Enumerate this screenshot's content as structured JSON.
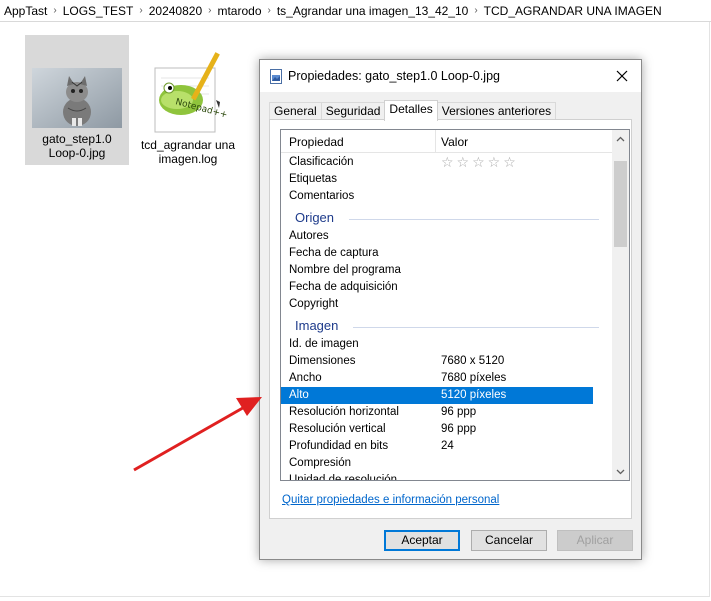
{
  "breadcrumb": [
    "AppTast",
    "LOGS_TEST",
    "20240820",
    "mtarodo",
    "ts_Agrandar una imagen_13_42_10",
    "TCD_AGRANDAR UNA IMAGEN"
  ],
  "files": [
    {
      "name_line1": "gato_step1.0",
      "name_line2": "Loop-0.jpg",
      "icon": "image-thumbnail-icon"
    },
    {
      "name_line1": "tcd_agrandar una",
      "name_line2": "imagen.log",
      "icon": "notepad-plus-plus-icon"
    }
  ],
  "dialog": {
    "title": "Propiedades: gato_step1.0 Loop-0.jpg",
    "tabs": [
      "General",
      "Seguridad",
      "Detalles",
      "Versiones anteriores"
    ],
    "active_tab": "Detalles",
    "header_property": "Propiedad",
    "header_value": "Valor",
    "rows_top": [
      {
        "key": "Clasificación",
        "value": "",
        "stars": "☆☆☆☆☆"
      },
      {
        "key": "Etiquetas",
        "value": ""
      },
      {
        "key": "Comentarios",
        "value": ""
      }
    ],
    "group_origin": "Origen",
    "rows_origin": [
      {
        "key": "Autores",
        "value": ""
      },
      {
        "key": "Fecha de captura",
        "value": ""
      },
      {
        "key": "Nombre del programa",
        "value": ""
      },
      {
        "key": "Fecha de adquisición",
        "value": ""
      },
      {
        "key": "Copyright",
        "value": ""
      }
    ],
    "group_image": "Imagen",
    "rows_image": [
      {
        "key": "Id. de imagen",
        "value": ""
      },
      {
        "key": "Dimensiones",
        "value": "7680 x 5120"
      },
      {
        "key": "Ancho",
        "value": "7680 píxeles"
      },
      {
        "key": "Alto",
        "value": "5120 píxeles"
      },
      {
        "key": "Resolución horizontal",
        "value": "96 ppp"
      },
      {
        "key": "Resolución vertical",
        "value": "96 ppp"
      },
      {
        "key": "Profundidad en bits",
        "value": "24"
      },
      {
        "key": "Compresión",
        "value": ""
      },
      {
        "key": "Unidad de resolución",
        "value": ""
      }
    ],
    "selected_row": "Alto",
    "link": "Quitar propiedades e información personal",
    "buttons": {
      "ok": "Aceptar",
      "cancel": "Cancelar",
      "apply": "Aplicar"
    }
  },
  "colors": {
    "selection": "#0078d7",
    "group_title": "#1e3b8b",
    "link": "#0066cc",
    "annotation_arrow": "#e02020"
  }
}
